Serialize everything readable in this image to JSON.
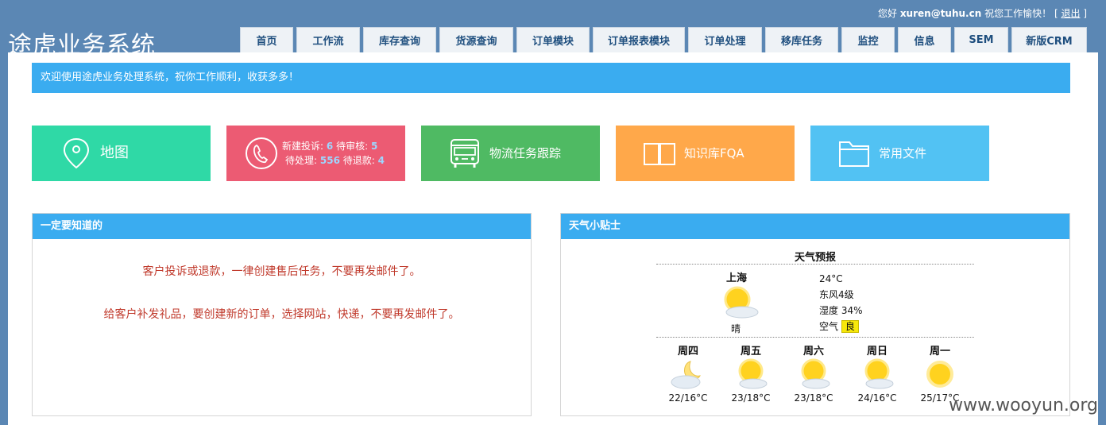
{
  "header": {
    "greeting": "您好",
    "user": "xuren@tuhu.cn",
    "wish": "祝您工作愉快！",
    "bracket_open": "[",
    "logout": "退出",
    "bracket_close": "]",
    "app_title": "途虎业务系统"
  },
  "nav": {
    "tabs": [
      {
        "label": "首页"
      },
      {
        "label": "工作流"
      },
      {
        "label": "库存查询"
      },
      {
        "label": "货源查询"
      },
      {
        "label": "订单模块"
      },
      {
        "label": "订单报表模块"
      },
      {
        "label": "订单处理"
      },
      {
        "label": "移库任务"
      },
      {
        "label": "监控"
      },
      {
        "label": "信息"
      },
      {
        "label": "SEM"
      },
      {
        "label": "新版CRM"
      }
    ]
  },
  "welcome": "欢迎使用途虎业务处理系统，祝你工作顺利，收获多多！",
  "tiles": {
    "map": {
      "label": "地图",
      "icon": "location-pin-icon",
      "color": "#2fd9a6"
    },
    "complaint": {
      "icon": "phone-icon",
      "color": "#ec5b73",
      "new_label": "新建投诉:",
      "new_value": "6",
      "review_label": "待审核:",
      "review_value": "5",
      "pending_label": "待处理:",
      "pending_value": "556",
      "refund_label": "待退款:",
      "refund_value": "4"
    },
    "logistics": {
      "label": "物流任务跟踪",
      "icon": "bus-icon",
      "color": "#4fba63"
    },
    "faq": {
      "label": "知识库FQA",
      "icon": "book-icon",
      "color": "#ffa84a"
    },
    "files": {
      "label": "常用文件",
      "icon": "folder-icon",
      "color": "#52c2f3"
    }
  },
  "notice_panel": {
    "title": "一定要知道的",
    "line1": "客户投诉或退款，一律创建售后任务，不要再发邮件了。",
    "line2": "给客户补发礼品，要创建新的订单，选择网站，快递，不要再发邮件了。"
  },
  "weather_panel": {
    "title": "天气小贴士",
    "forecast_title": "天气预报",
    "city": "上海",
    "condition": "晴",
    "temp": "24°C",
    "wind": "东风4级",
    "humidity": "湿度 34%",
    "air_label": "空气",
    "air_value": "良",
    "days": [
      {
        "name": "周四",
        "temp": "22/16°C",
        "icon": "moon-cloud-icon"
      },
      {
        "name": "周五",
        "temp": "23/18°C",
        "icon": "sun-cloud-icon"
      },
      {
        "name": "周六",
        "temp": "23/18°C",
        "icon": "sun-cloud-icon"
      },
      {
        "name": "周日",
        "temp": "24/16°C",
        "icon": "sun-cloud-icon"
      },
      {
        "name": "周一",
        "temp": "25/17°C",
        "icon": "sun-icon"
      }
    ]
  },
  "watermark": "www.wooyun.org"
}
